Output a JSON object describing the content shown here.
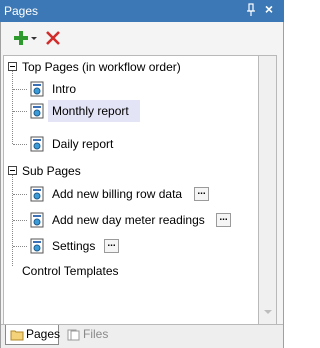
{
  "window": {
    "title": "Pages",
    "pin_glyph": "pin-icon",
    "close_glyph": "×"
  },
  "toolbar": {
    "add_icon": "plus-icon",
    "dropdown_icon": "chevron-down-icon",
    "delete_icon": "x-icon"
  },
  "tree": {
    "groups": [
      {
        "label": "Top Pages (in workflow order)",
        "items": [
          {
            "label": "Intro",
            "selected": false,
            "has_button": false
          },
          {
            "label": "Monthly report",
            "selected": true,
            "has_button": false
          },
          {
            "label": "Daily report",
            "selected": false,
            "has_button": false
          }
        ]
      },
      {
        "label": "Sub Pages",
        "items": [
          {
            "label": "Add new billing row data",
            "selected": false,
            "has_button": true,
            "button_label": "..."
          },
          {
            "label": "Add new day meter readings",
            "selected": false,
            "has_button": true,
            "button_label": "..."
          },
          {
            "label": "Settings",
            "selected": false,
            "has_button": true,
            "button_label": "..."
          }
        ]
      }
    ],
    "footer_label": "Control Templates"
  },
  "tabs": [
    {
      "label": "Pages",
      "active": true,
      "icon": "folder-icon"
    },
    {
      "label": "Files",
      "active": false,
      "icon": "files-icon"
    }
  ],
  "colors": {
    "titlebar": "#3c78b5",
    "selection": "#e4e4f7",
    "add_green": "#2e9a2e",
    "delete_red": "#d22b2b"
  }
}
